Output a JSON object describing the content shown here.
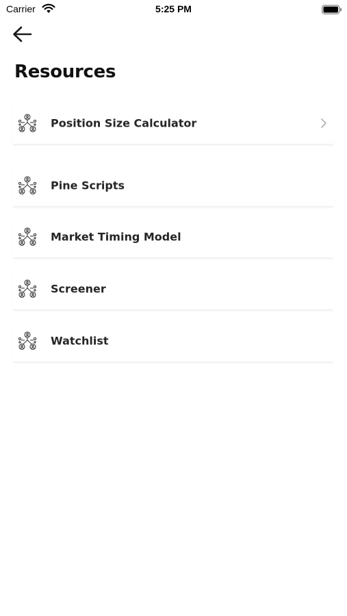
{
  "status_bar": {
    "carrier": "Carrier",
    "time": "5:25 PM",
    "wifi_icon": "wifi-icon",
    "battery_icon": "battery-icon"
  },
  "header": {
    "back_icon": "arrow-left-icon",
    "title": "Resources"
  },
  "resources": {
    "icon": "network-people-icon",
    "chevron_icon": "chevron-right-icon",
    "items": [
      {
        "label": "Position Size Calculator",
        "show_chevron": true
      },
      {
        "label": "Pine Scripts",
        "show_chevron": false
      },
      {
        "label": "Market Timing Model",
        "show_chevron": false
      },
      {
        "label": "Screener",
        "show_chevron": false
      },
      {
        "label": "Watchlist",
        "show_chevron": false
      }
    ]
  },
  "colors": {
    "background": "#ffffff",
    "text": "#262626",
    "icon": "#3a3a3a",
    "chevron": "#b0b0b0"
  }
}
